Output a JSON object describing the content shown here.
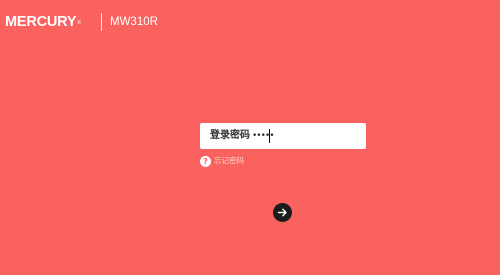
{
  "header": {
    "brand": "MERCURY",
    "brand_mark": "®",
    "model": "MW310R"
  },
  "login": {
    "label": "登录密码",
    "password_value": "•••••"
  },
  "forgot": {
    "icon": "help-icon",
    "icon_glyph": "?",
    "label": "忘记密码"
  },
  "submit": {
    "icon": "arrow-right-icon"
  },
  "colors": {
    "background": "#f9625e",
    "button": "#1c1c1c",
    "card": "#ffffff"
  }
}
